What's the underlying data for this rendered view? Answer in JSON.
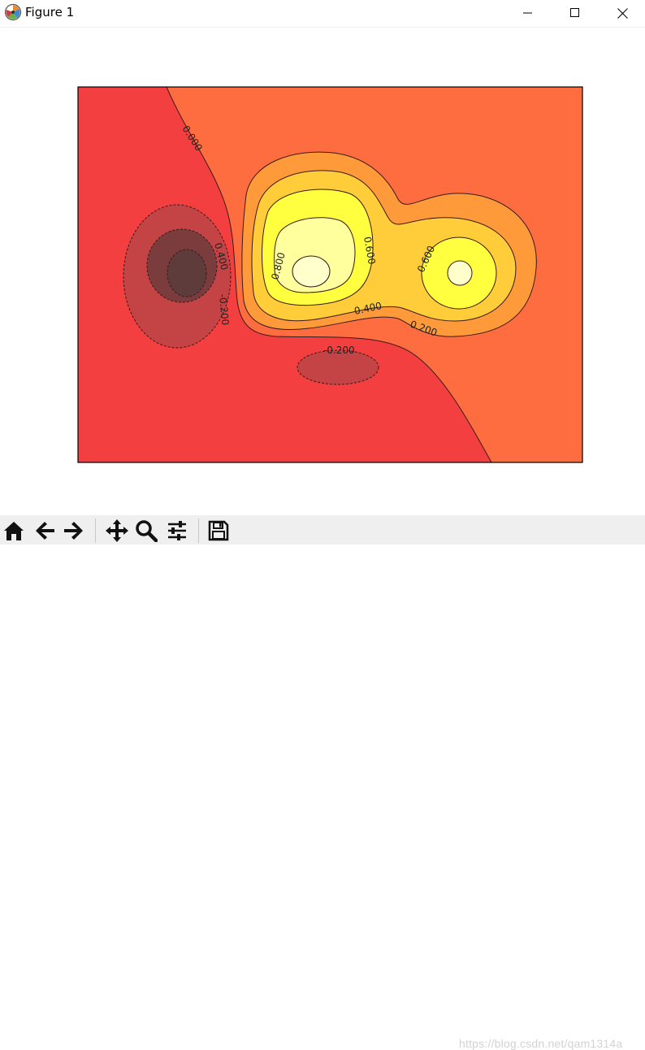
{
  "window": {
    "title": "Figure 1",
    "icon": "matplotlib-icon",
    "controls": [
      "minimize-icon",
      "maximize-icon",
      "close-icon"
    ]
  },
  "toolbar": {
    "buttons": [
      {
        "name": "home-button",
        "icon": "home-icon"
      },
      {
        "name": "back-button",
        "icon": "arrow-left-icon"
      },
      {
        "name": "forward-button",
        "icon": "arrow-right-icon"
      },
      {
        "name": "pan-button",
        "icon": "move-icon"
      },
      {
        "name": "zoom-button",
        "icon": "magnifier-icon"
      },
      {
        "name": "subplots-button",
        "icon": "sliders-icon"
      },
      {
        "name": "save-button",
        "icon": "floppy-disk-icon"
      }
    ]
  },
  "watermark": "https://blog.csdn.net/qam1314a",
  "chart_data": {
    "type": "contour",
    "title": "",
    "xlabel": "",
    "ylabel": "",
    "colormap": "hot",
    "levels": [
      -0.2,
      0.0,
      0.2,
      0.4,
      0.6,
      0.8
    ],
    "contour_labels": [
      "0.000",
      "0.400",
      "-0.200",
      "0.800",
      "0.600",
      "0.600",
      "0.400",
      "0.200",
      "-0.200"
    ],
    "peaks": [
      {
        "sign": "positive",
        "max_level": 0.8
      },
      {
        "sign": "positive",
        "max_level": 0.8
      },
      {
        "sign": "negative",
        "min_level": -0.6
      },
      {
        "sign": "negative",
        "min_level": -0.2
      }
    ],
    "colors": {
      "below_minus_0.6": "#5e3c3c",
      "minus_0.6_to_minus_0.4": "#7a3c3c",
      "minus_0.4_to_minus_0.2": "#c44445",
      "minus_0.2_to_0.0": "#f33f3f",
      "0.0_to_0.2": "#fe6d3f",
      "0.2_to_0.4": "#fe9a3a",
      "0.4_to_0.6": "#ffcc3a",
      "0.6_to_0.8": "#ffff40",
      "above_0.8": "#ffffcc"
    },
    "grid": false,
    "axes_ticks": false
  }
}
